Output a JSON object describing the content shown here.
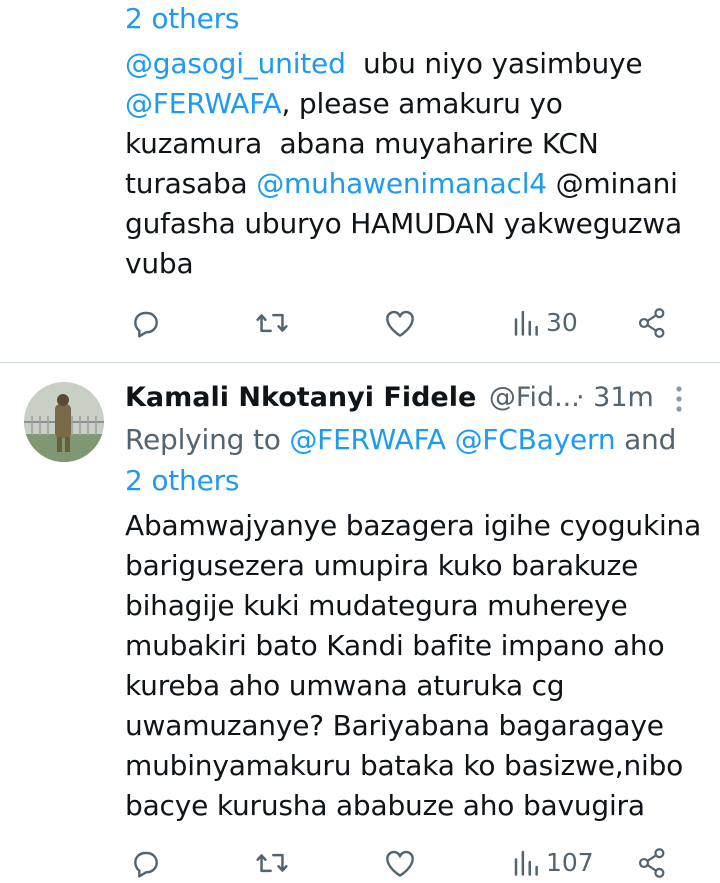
{
  "tweet1": {
    "reply_tail": "2 others",
    "body_lines": [
      [
        {
          "t": "@gasogi_united",
          "link": true
        },
        {
          "t": "  ubu niyo yasimbuye",
          "link": false
        }
      ],
      [
        {
          "t": "@FERWAFA",
          "link": true
        },
        {
          "t": ", please amakuru yo",
          "link": false
        }
      ],
      [
        {
          "t": "kuzamura  abana muyaharire KCN",
          "link": false
        }
      ],
      [
        {
          "t": "turasaba ",
          "link": false
        },
        {
          "t": "@muhawenimanacl4",
          "link": true
        },
        {
          "t": " @minani",
          "link": false
        }
      ],
      [
        {
          "t": "gufasha uburyo HAMUDAN yakweguzwa",
          "link": false
        }
      ],
      [
        {
          "t": "vuba",
          "link": false
        }
      ]
    ],
    "views": "30"
  },
  "tweet2": {
    "name": "Kamali Nkotanyi Fidele",
    "handle": "@Fid...",
    "time": "· 31m",
    "replying_prefix": "Replying to ",
    "replying_mentions": "@FERWAFA @FCBayern",
    "replying_and": " and",
    "replying_others": "2 others",
    "body_lines": [
      "Abamwajyanye bazagera igihe cyogukina",
      "barigusezera umupira kuko barakuze",
      "bihagije kuki mudategura muhereye",
      "mubakiri bato Kandi bafite impano aho",
      "kureba aho umwana aturuka cg",
      "uwamuzanye? Bariyabana bagaragaye",
      "mubinyamakuru bataka ko basizwe,nibo",
      "bacye kurusha ababuze aho bavugira"
    ],
    "views": "107"
  },
  "icons": [
    "reply-icon",
    "retweet-icon",
    "like-icon",
    "views-icon",
    "share-icon",
    "more-icon"
  ],
  "colors": {
    "link": "#1d9bf0",
    "muted": "#536471",
    "text": "#0f1419"
  }
}
